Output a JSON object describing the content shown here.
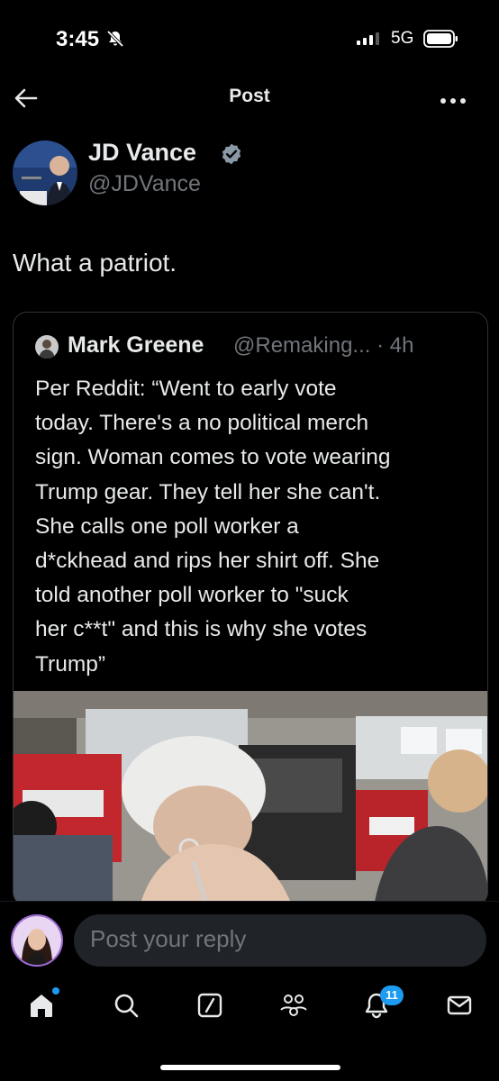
{
  "status_bar": {
    "time": "3:45",
    "network": "5G"
  },
  "nav": {
    "title": "Post"
  },
  "post": {
    "author_name": "JD Vance",
    "author_handle": "@JDVance",
    "text": "What a patriot."
  },
  "quote": {
    "author_name": "Mark Greene",
    "author_handle": "@Remaking...",
    "time_ago": "4h",
    "lines": [
      "Per Reddit: “Went to early vote",
      "today. There's a no political merch",
      "sign. Woman comes to vote wearing",
      "Trump gear. They tell her she can't.",
      "She calls one poll worker a",
      "d*ckhead and rips her shirt off. She",
      "told another poll worker to \"suck",
      "her c**t\" and this is why she votes",
      "Trump”"
    ]
  },
  "reply": {
    "placeholder": "Post your reply"
  },
  "tabbar": {
    "notifications_badge": "11"
  },
  "colors": {
    "accent": "#1d9bf0",
    "background": "#000000",
    "secondary_text": "#71767b"
  }
}
